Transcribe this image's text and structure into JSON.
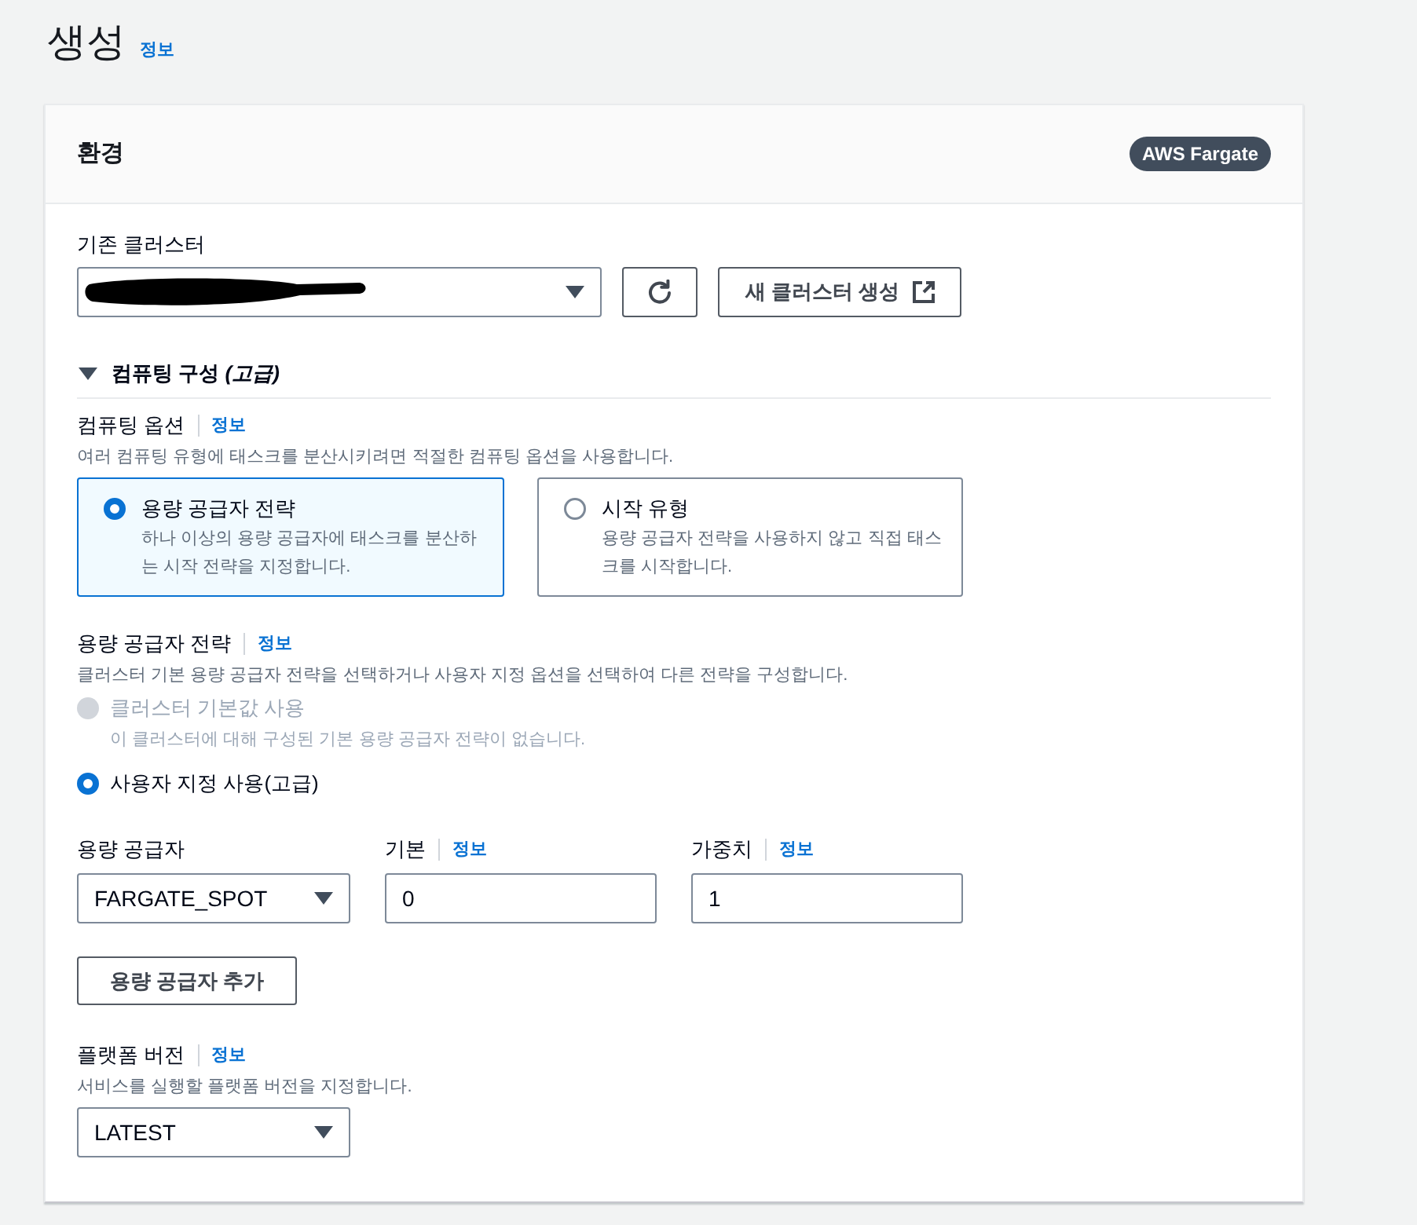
{
  "page": {
    "title": "생성",
    "info_link": "정보"
  },
  "panel": {
    "title": "환경",
    "badge": "AWS Fargate"
  },
  "cluster": {
    "label": "기존 클러스터",
    "redacted": true,
    "new_cluster_button": "새 클러스터 생성"
  },
  "compute_section": {
    "title": "컴퓨팅 구성 *(고급)*",
    "expanded": true,
    "compute_options": {
      "label": "컴퓨팅 옵션",
      "info_link": "정보",
      "description": "여러 컴퓨팅 유형에 태스크를 분산시키려면 적절한 컴퓨팅 옵션을 사용합니다.",
      "tiles": [
        {
          "title": "용량 공급자 전략",
          "description": "하나 이상의 용량 공급자에 태스크를 분산하는 시작 전략을 지정합니다.",
          "selected": true
        },
        {
          "title": "시작 유형",
          "description": "용량 공급자 전략을 사용하지 않고 직접 태스크를 시작합니다.",
          "selected": false
        }
      ]
    },
    "strategy": {
      "label": "용량 공급자 전략",
      "info_link": "정보",
      "description": "클러스터 기본 용량 공급자 전략을 선택하거나 사용자 지정 옵션을 선택하여 다른 전략을 구성합니다.",
      "options": [
        {
          "label": "클러스터 기본값 사용",
          "description": "이 클러스터에 대해 구성된 기본 용량 공급자 전략이 없습니다.",
          "selected": false,
          "disabled": true
        },
        {
          "label": "사용자 지정 사용(고급)",
          "selected": true,
          "disabled": false
        }
      ]
    },
    "providers": {
      "columns": [
        {
          "label": "용량 공급자"
        },
        {
          "label": "기본",
          "info_link": "정보"
        },
        {
          "label": "가중치",
          "info_link": "정보"
        }
      ],
      "rows": [
        {
          "provider": "FARGATE_SPOT",
          "base": "0",
          "weight": "1"
        }
      ],
      "add_button": "용량 공급자 추가"
    },
    "platform": {
      "label": "플랫폼 버전",
      "info_link": "정보",
      "description": "서비스를 실행할 플랫폼 버전을 지정합니다.",
      "value": "LATEST"
    }
  }
}
